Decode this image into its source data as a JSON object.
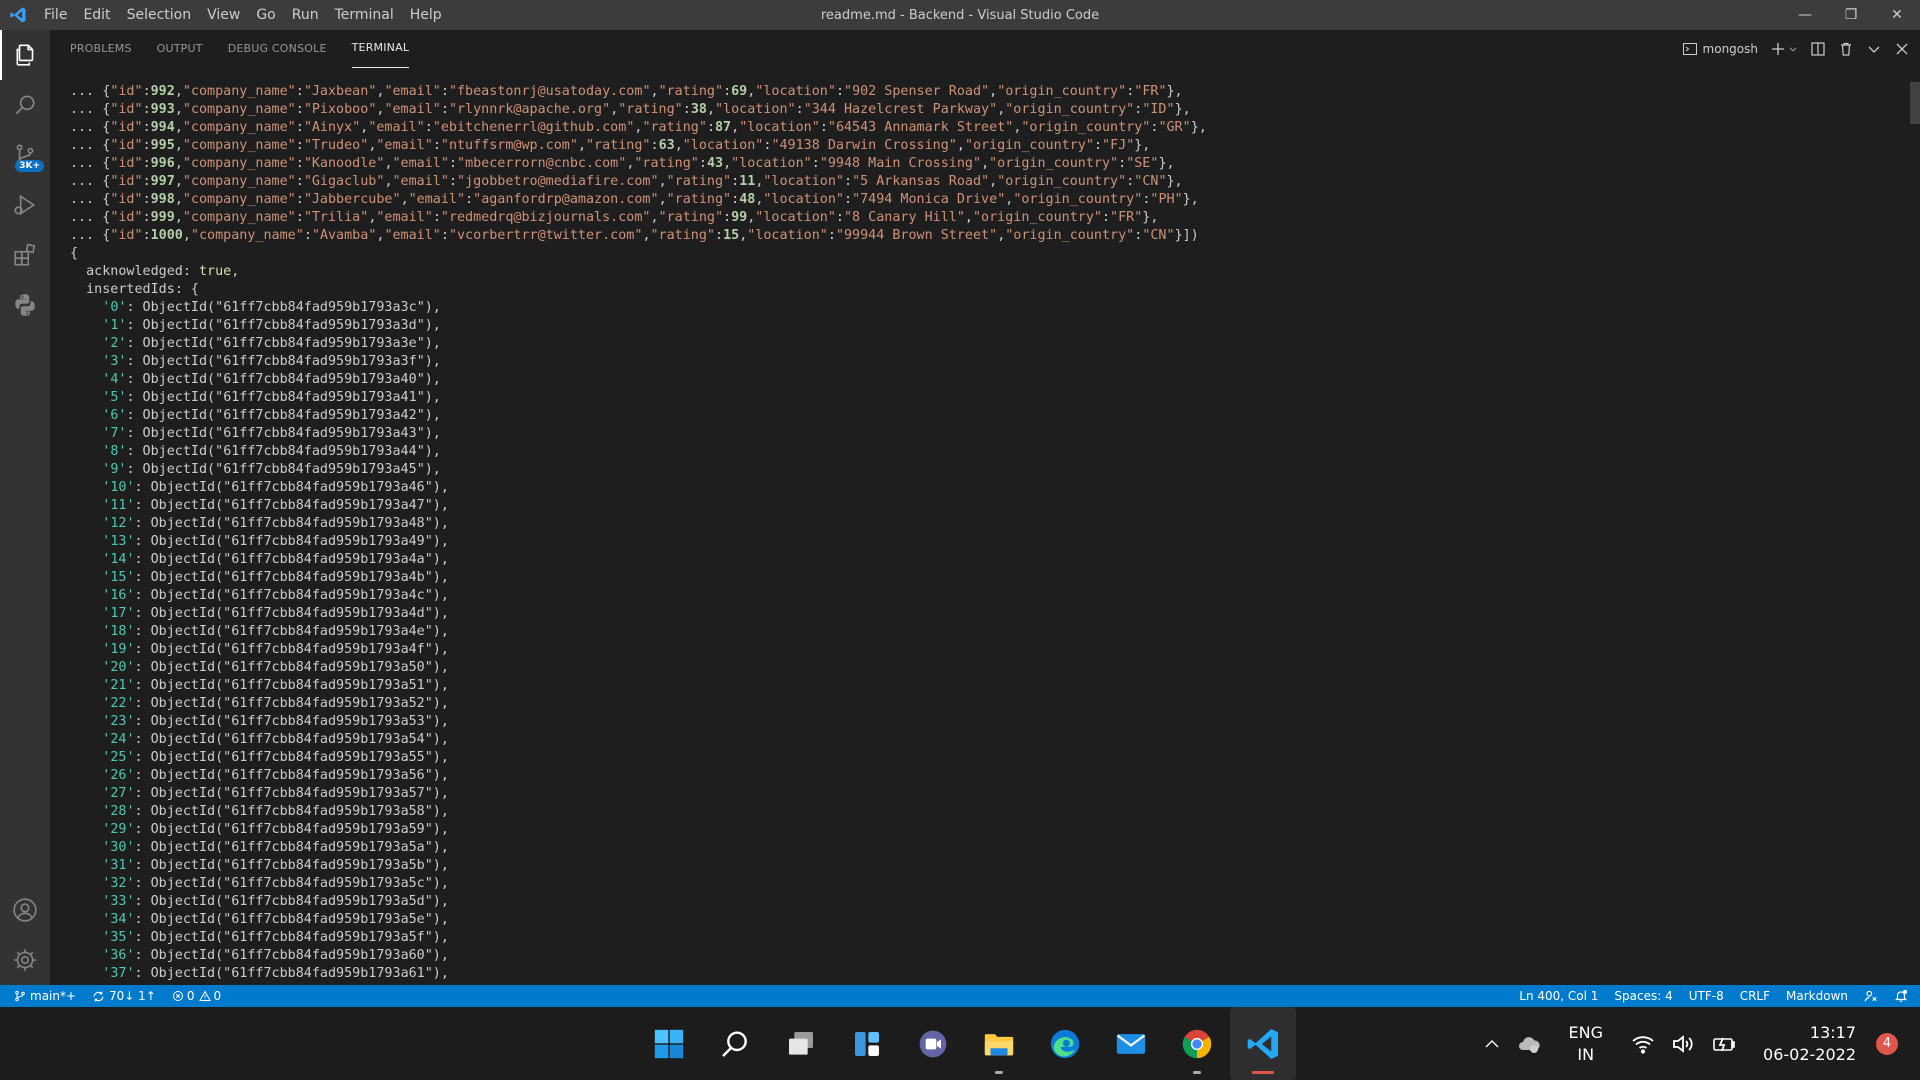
{
  "titlebar": {
    "menus": [
      "File",
      "Edit",
      "Selection",
      "View",
      "Go",
      "Run",
      "Terminal",
      "Help"
    ],
    "title": "readme.md - Backend - Visual Studio Code",
    "controls": {
      "minimize": "—",
      "restore": "❐",
      "close": "✕"
    }
  },
  "activitybar": {
    "source_control_badge": "3K+"
  },
  "panel": {
    "tabs": [
      "PROBLEMS",
      "OUTPUT",
      "DEBUG CONSOLE",
      "TERMINAL"
    ],
    "active_tab": "TERMINAL",
    "terminal_name": "mongosh"
  },
  "terminal": {
    "prefix": "... ",
    "records": [
      {
        "id": "992",
        "company_name": "Jaxbean",
        "email": "fbeastonrj@usatoday.com",
        "rating": "69",
        "location": "902 Spenser Road",
        "origin_country": "FR"
      },
      {
        "id": "993",
        "company_name": "Pixoboo",
        "email": "rlynnrk@apache.org",
        "rating": "38",
        "location": "344 Hazelcrest Parkway",
        "origin_country": "ID"
      },
      {
        "id": "994",
        "company_name": "Ainyx",
        "email": "ebitchenerrl@github.com",
        "rating": "87",
        "location": "64543 Annamark Street",
        "origin_country": "GR"
      },
      {
        "id": "995",
        "company_name": "Trudeo",
        "email": "ntuffsrm@wp.com",
        "rating": "63",
        "location": "49138 Darwin Crossing",
        "origin_country": "FJ"
      },
      {
        "id": "996",
        "company_name": "Kanoodle",
        "email": "mbecerrorn@cnbc.com",
        "rating": "43",
        "location": "9948 Main Crossing",
        "origin_country": "SE"
      },
      {
        "id": "997",
        "company_name": "Gigaclub",
        "email": "jgobbetro@mediafire.com",
        "rating": "11",
        "location": "5 Arkansas Road",
        "origin_country": "CN"
      },
      {
        "id": "998",
        "company_name": "Jabbercube",
        "email": "aganfordrp@amazon.com",
        "rating": "48",
        "location": "7494 Monica Drive",
        "origin_country": "PH"
      },
      {
        "id": "999",
        "company_name": "Trilia",
        "email": "redmedrq@bizjournals.com",
        "rating": "99",
        "location": "8 Canary Hill",
        "origin_country": "FR"
      },
      {
        "id": "1000",
        "company_name": "Avamba",
        "email": "vcorbertrr@twitter.com",
        "rating": "15",
        "location": "99944 Brown Street",
        "origin_country": "CN"
      }
    ],
    "result_open": "{",
    "acknowledged_key": "acknowledged",
    "acknowledged_value": "true",
    "inserted_ids_key": "insertedIds",
    "object_id_prefix": "61ff7cbb84fad959b1793",
    "inserted_ids": [
      {
        "index": "0",
        "suffix": "a3c"
      },
      {
        "index": "1",
        "suffix": "a3d"
      },
      {
        "index": "2",
        "suffix": "a3e"
      },
      {
        "index": "3",
        "suffix": "a3f"
      },
      {
        "index": "4",
        "suffix": "a40"
      },
      {
        "index": "5",
        "suffix": "a41"
      },
      {
        "index": "6",
        "suffix": "a42"
      },
      {
        "index": "7",
        "suffix": "a43"
      },
      {
        "index": "8",
        "suffix": "a44"
      },
      {
        "index": "9",
        "suffix": "a45"
      },
      {
        "index": "10",
        "suffix": "a46"
      },
      {
        "index": "11",
        "suffix": "a47"
      },
      {
        "index": "12",
        "suffix": "a48"
      },
      {
        "index": "13",
        "suffix": "a49"
      },
      {
        "index": "14",
        "suffix": "a4a"
      },
      {
        "index": "15",
        "suffix": "a4b"
      },
      {
        "index": "16",
        "suffix": "a4c"
      },
      {
        "index": "17",
        "suffix": "a4d"
      },
      {
        "index": "18",
        "suffix": "a4e"
      },
      {
        "index": "19",
        "suffix": "a4f"
      },
      {
        "index": "20",
        "suffix": "a50"
      },
      {
        "index": "21",
        "suffix": "a51"
      },
      {
        "index": "22",
        "suffix": "a52"
      },
      {
        "index": "23",
        "suffix": "a53"
      },
      {
        "index": "24",
        "suffix": "a54"
      },
      {
        "index": "25",
        "suffix": "a55"
      },
      {
        "index": "26",
        "suffix": "a56"
      },
      {
        "index": "27",
        "suffix": "a57"
      },
      {
        "index": "28",
        "suffix": "a58"
      },
      {
        "index": "29",
        "suffix": "a59"
      },
      {
        "index": "30",
        "suffix": "a5a"
      },
      {
        "index": "31",
        "suffix": "a5b"
      },
      {
        "index": "32",
        "suffix": "a5c"
      },
      {
        "index": "33",
        "suffix": "a5d"
      },
      {
        "index": "34",
        "suffix": "a5e"
      },
      {
        "index": "35",
        "suffix": "a5f"
      },
      {
        "index": "36",
        "suffix": "a60"
      },
      {
        "index": "37",
        "suffix": "a61"
      }
    ]
  },
  "statusbar": {
    "branch": "main*+",
    "sync": "70↓ 1↑",
    "errors": "0",
    "warnings": "0",
    "cursor": "Ln 400, Col 1",
    "spaces": "Spaces: 4",
    "encoding": "UTF-8",
    "eol": "CRLF",
    "language": "Markdown"
  },
  "taskbar": {
    "language_top": "ENG",
    "language_bottom": "IN",
    "time": "13:17",
    "date": "06-02-2022",
    "notifications": "4"
  },
  "colors": {
    "accent": "#007acc",
    "titlebar": "#3c3c3c",
    "activitybar": "#333333",
    "editor_bg": "#1e1e1e",
    "key_color": "#4ec9b0",
    "string_color": "#ce9178",
    "number_color": "#b5cea8"
  }
}
